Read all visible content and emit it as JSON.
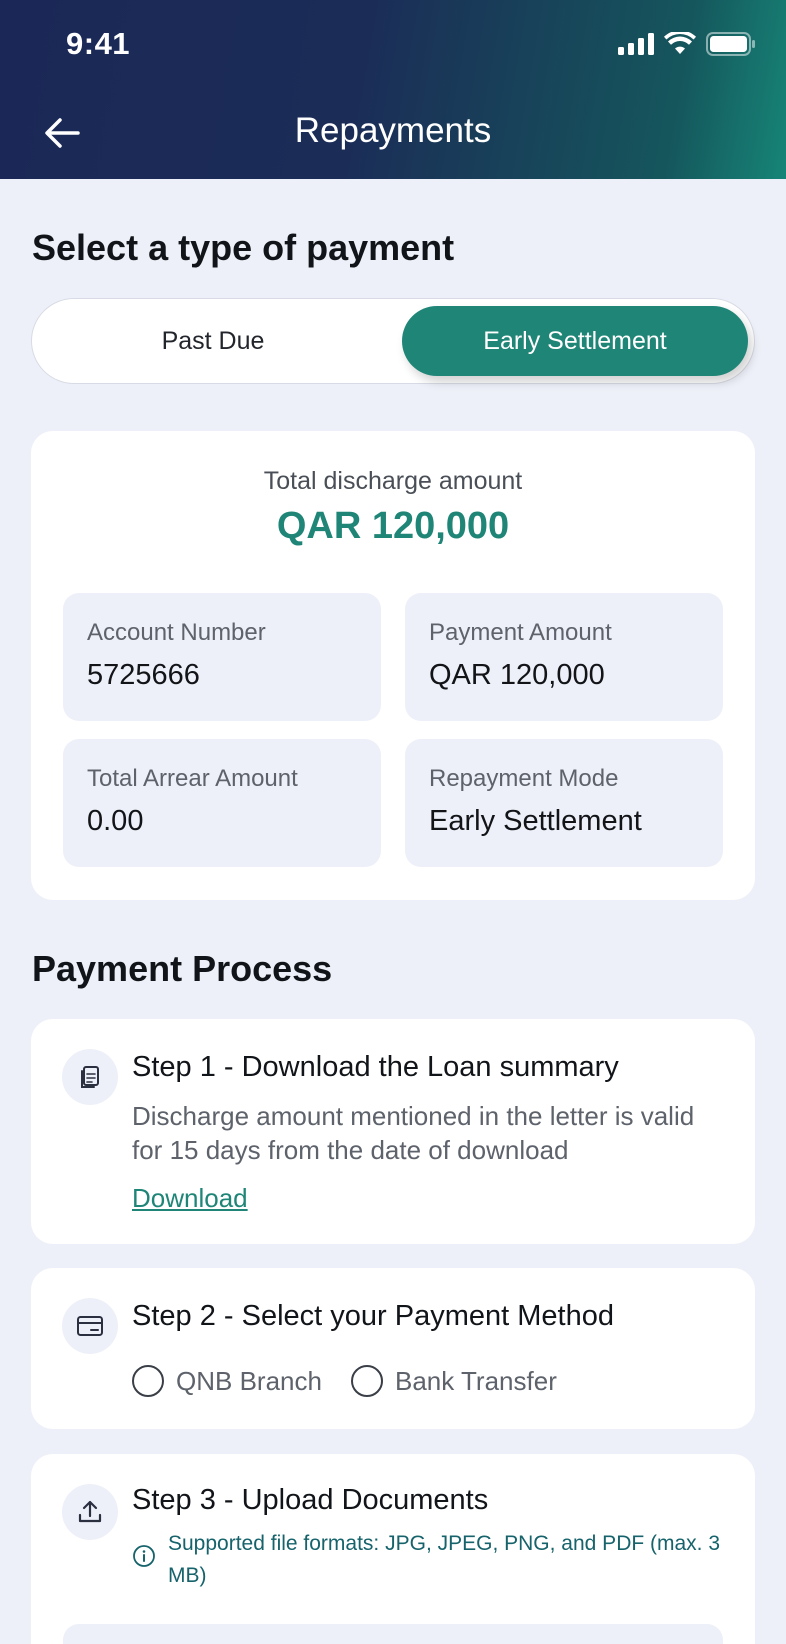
{
  "status_bar": {
    "time": "9:41"
  },
  "header": {
    "title": "Repayments"
  },
  "payment_type": {
    "heading": "Select a type of payment",
    "options": [
      "Past Due",
      "Early Settlement"
    ],
    "selected": "Early Settlement"
  },
  "summary": {
    "label": "Total discharge amount",
    "amount": "QAR 120,000",
    "tiles": [
      {
        "label": "Account Number",
        "value": "5725666"
      },
      {
        "label": "Payment Amount",
        "value": "QAR 120,000"
      },
      {
        "label": "Total Arrear Amount",
        "value": "0.00"
      },
      {
        "label": "Repayment Mode",
        "value": "Early Settlement"
      }
    ]
  },
  "process": {
    "heading": "Payment Process",
    "step1": {
      "title": "Step 1 - Download the Loan summary",
      "description": "Discharge amount mentioned in the letter is valid for 15 days from the date of download",
      "link": "Download",
      "icon": "document-icon"
    },
    "step2": {
      "title": "Step 2 - Select your Payment Method",
      "options": [
        "QNB Branch",
        "Bank Transfer"
      ],
      "icon": "card-icon"
    },
    "step3": {
      "title": "Step 3 - Upload Documents",
      "info": "Supported file formats: JPG, JPEG, PNG, and PDF (max. 3 MB)",
      "icon": "upload-icon"
    }
  },
  "colors": {
    "accent": "#1f8577",
    "background": "#eef0f9",
    "header_dark": "#1b2857"
  }
}
